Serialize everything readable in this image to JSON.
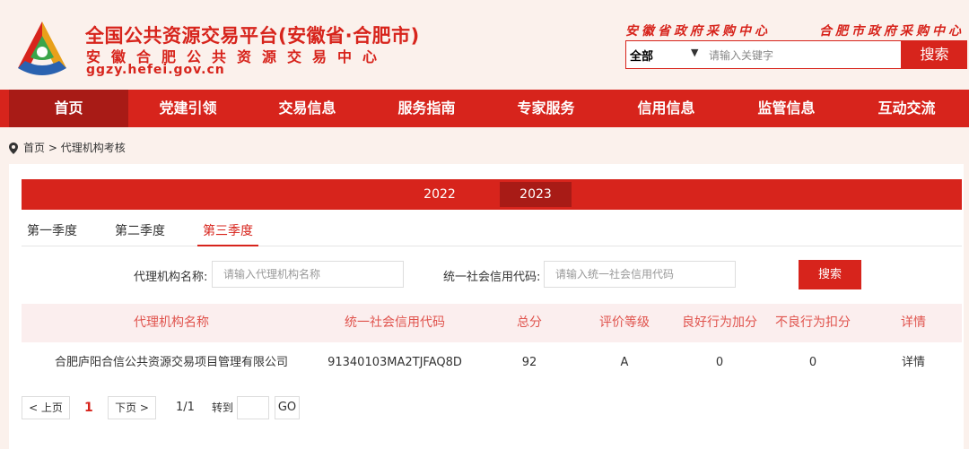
{
  "header": {
    "title": "全国公共资源交易平台(安徽省·合肥市)",
    "subtitle": "安徽合肥公共资源交易中心",
    "url": "ggzy.hefei.gov.cn",
    "link_province": "安徽省政府采购中心",
    "link_city": "合肥市政府采购中心",
    "search": {
      "selected": "全部",
      "placeholder": "请输入关键字",
      "button": "搜索"
    }
  },
  "nav": {
    "items": [
      {
        "label": "首页"
      },
      {
        "label": "党建引领"
      },
      {
        "label": "交易信息"
      },
      {
        "label": "服务指南"
      },
      {
        "label": "专家服务"
      },
      {
        "label": "信用信息"
      },
      {
        "label": "监管信息"
      },
      {
        "label": "互动交流"
      }
    ],
    "active_index": 0
  },
  "breadcrumb": {
    "home": "首页",
    "separator": ">",
    "current": "代理机构考核"
  },
  "years": {
    "items": [
      "2022",
      "2023"
    ],
    "active": "2023"
  },
  "quarters": {
    "items": [
      "第一季度",
      "第二季度",
      "第三季度"
    ],
    "active": "第三季度"
  },
  "filters": {
    "agency_label": "代理机构名称:",
    "agency_placeholder": "请输入代理机构名称",
    "credit_label": "统一社会信用代码:",
    "credit_placeholder": "请输入统一社会信用代码",
    "search_button": "搜索"
  },
  "table": {
    "headers": [
      "代理机构名称",
      "统一社会信用代码",
      "总分",
      "评价等级",
      "良好行为加分",
      "不良行为扣分",
      "详情"
    ],
    "rows": [
      {
        "name": "合肥庐阳合信公共资源交易项目管理有限公司",
        "code": "91340103MA2TJFAQ8D",
        "score": "92",
        "grade": "A",
        "bonus": "0",
        "penalty": "0",
        "detail": "详情"
      }
    ]
  },
  "pager": {
    "prev": "< 上页",
    "current": "1",
    "next": "下页 >",
    "pages": "1/1",
    "goto_label": "转到",
    "go_button": "GO"
  },
  "colors": {
    "brand_red": "#d7241c",
    "nav_active": "#a81b16",
    "header_bg": "#fbf1ec"
  }
}
